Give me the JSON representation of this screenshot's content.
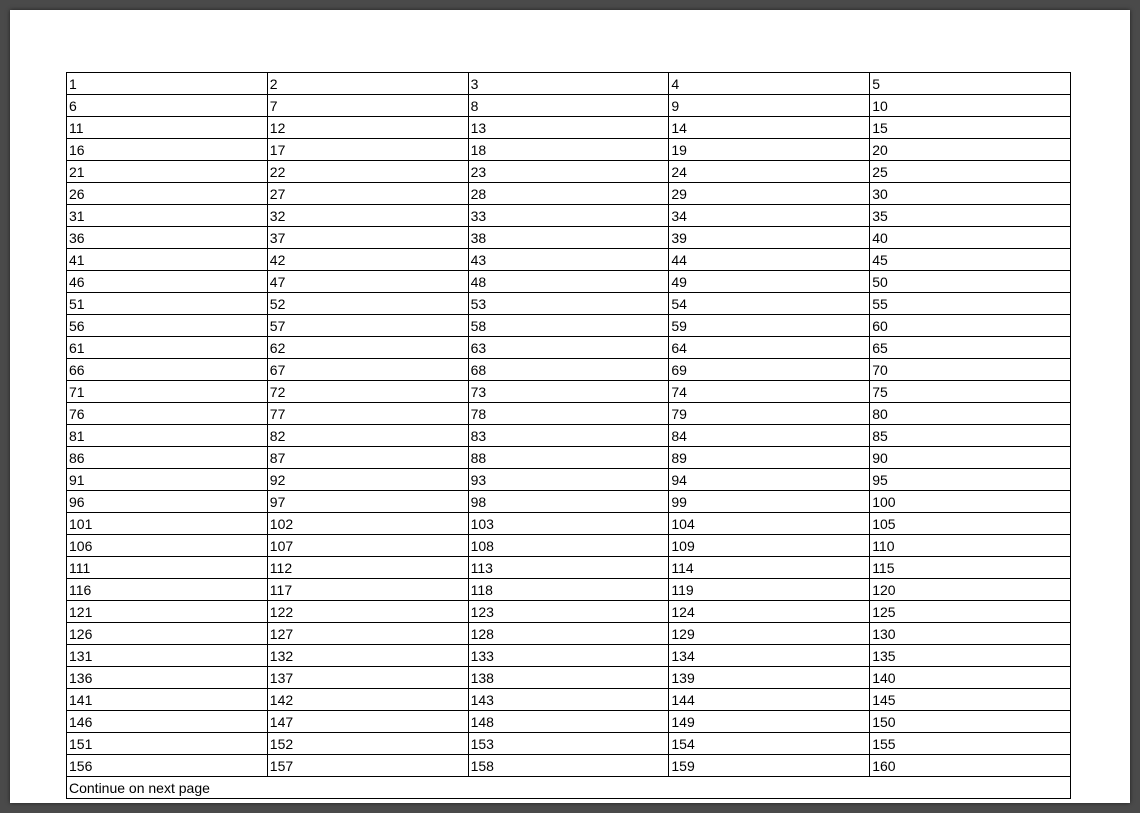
{
  "table": {
    "columns": 5,
    "rows": [
      [
        "1",
        "2",
        "3",
        "4",
        "5"
      ],
      [
        "6",
        "7",
        "8",
        "9",
        "10"
      ],
      [
        "11",
        "12",
        "13",
        "14",
        "15"
      ],
      [
        "16",
        "17",
        "18",
        "19",
        "20"
      ],
      [
        "21",
        "22",
        "23",
        "24",
        "25"
      ],
      [
        "26",
        "27",
        "28",
        "29",
        "30"
      ],
      [
        "31",
        "32",
        "33",
        "34",
        "35"
      ],
      [
        "36",
        "37",
        "38",
        "39",
        "40"
      ],
      [
        "41",
        "42",
        "43",
        "44",
        "45"
      ],
      [
        "46",
        "47",
        "48",
        "49",
        "50"
      ],
      [
        "51",
        "52",
        "53",
        "54",
        "55"
      ],
      [
        "56",
        "57",
        "58",
        "59",
        "60"
      ],
      [
        "61",
        "62",
        "63",
        "64",
        "65"
      ],
      [
        "66",
        "67",
        "68",
        "69",
        "70"
      ],
      [
        "71",
        "72",
        "73",
        "74",
        "75"
      ],
      [
        "76",
        "77",
        "78",
        "79",
        "80"
      ],
      [
        "81",
        "82",
        "83",
        "84",
        "85"
      ],
      [
        "86",
        "87",
        "88",
        "89",
        "90"
      ],
      [
        "91",
        "92",
        "93",
        "94",
        "95"
      ],
      [
        "96",
        "97",
        "98",
        "99",
        "100"
      ],
      [
        "101",
        "102",
        "103",
        "104",
        "105"
      ],
      [
        "106",
        "107",
        "108",
        "109",
        "110"
      ],
      [
        "111",
        "112",
        "113",
        "114",
        "115"
      ],
      [
        "116",
        "117",
        "118",
        "119",
        "120"
      ],
      [
        "121",
        "122",
        "123",
        "124",
        "125"
      ],
      [
        "126",
        "127",
        "128",
        "129",
        "130"
      ],
      [
        "131",
        "132",
        "133",
        "134",
        "135"
      ],
      [
        "136",
        "137",
        "138",
        "139",
        "140"
      ],
      [
        "141",
        "142",
        "143",
        "144",
        "145"
      ],
      [
        "146",
        "147",
        "148",
        "149",
        "150"
      ],
      [
        "151",
        "152",
        "153",
        "154",
        "155"
      ],
      [
        "156",
        "157",
        "158",
        "159",
        "160"
      ]
    ],
    "footer": "Continue on next page"
  }
}
